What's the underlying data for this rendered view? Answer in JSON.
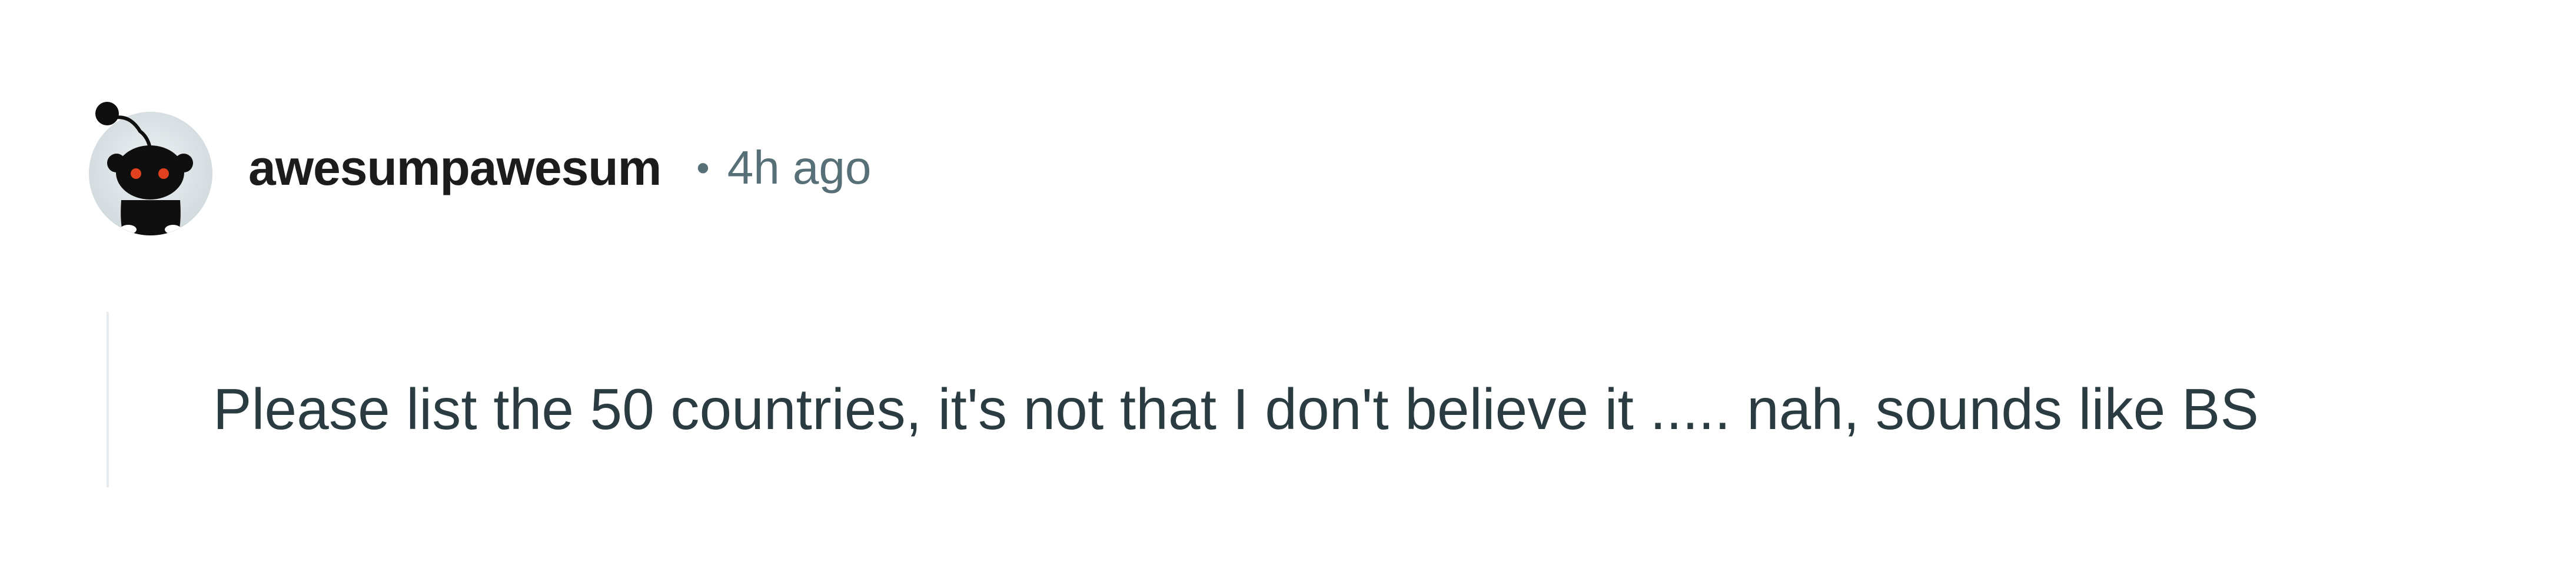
{
  "comment": {
    "author": "awesumpawesum",
    "separator": "•",
    "timestamp": "4h ago",
    "body": "Please list the 50 countries, it's not that I don't believe it ..... nah, sounds like BS",
    "avatar_icon": "snoo-avatar-icon"
  },
  "colors": {
    "username": "#1c1c1c",
    "meta": "#576f76",
    "body_text": "#2a3c42",
    "thread_line": "#e5ebee",
    "avatar_bg": "#d7dfe2",
    "avatar_figure": "#0f0f0f",
    "avatar_eyes": "#e0421f"
  }
}
